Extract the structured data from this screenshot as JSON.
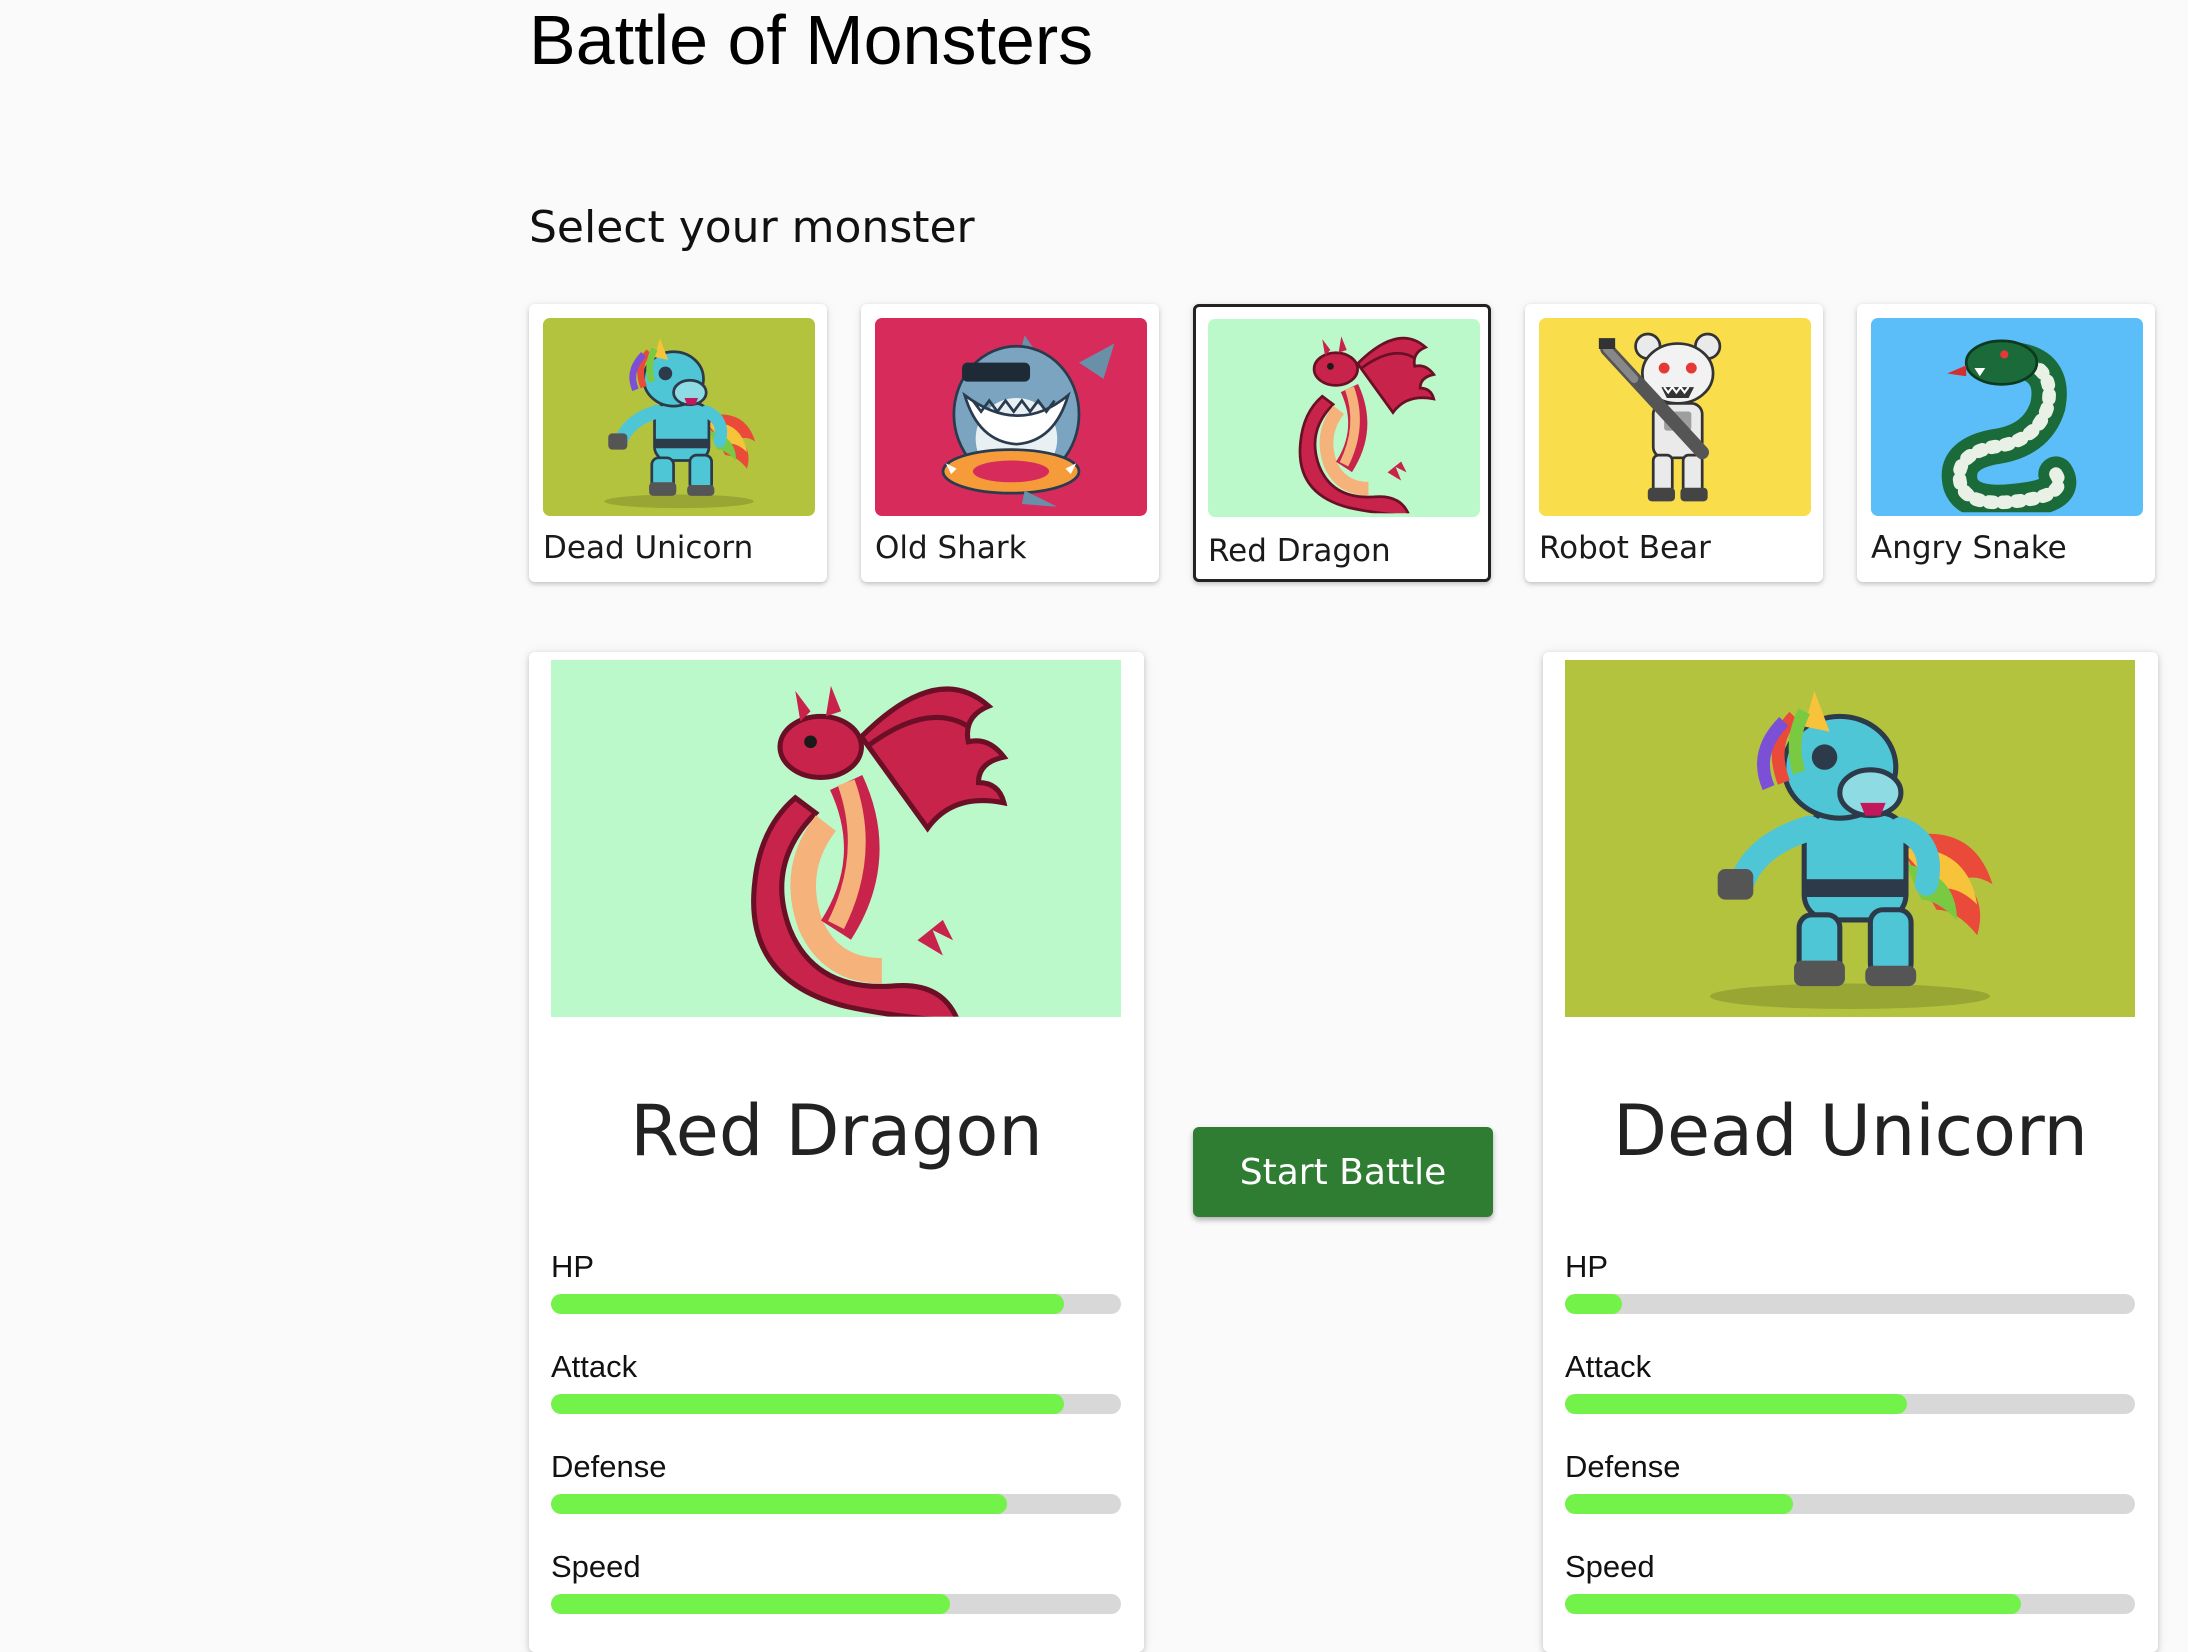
{
  "page": {
    "title": "Battle of Monsters",
    "subtitle": "Select your monster"
  },
  "monsters": [
    {
      "name": "Dead Unicorn",
      "bg": "#b3c33e",
      "icon": "unicorn-icon"
    },
    {
      "name": "Old Shark",
      "bg": "#d72b5c",
      "icon": "shark-icon"
    },
    {
      "name": "Red Dragon",
      "bg": "#bbf9cb",
      "icon": "dragon-icon",
      "selected": true
    },
    {
      "name": "Robot Bear",
      "bg": "#fadd4a",
      "icon": "bear-icon"
    },
    {
      "name": "Angry Snake",
      "bg": "#5bbef8",
      "icon": "snake-icon"
    }
  ],
  "player": {
    "name": "Red Dragon",
    "bg": "#bbf9cb",
    "stats": [
      {
        "label": "HP",
        "fill": 0.9
      },
      {
        "label": "Attack",
        "fill": 0.9
      },
      {
        "label": "Defense",
        "fill": 0.8
      },
      {
        "label": "Speed",
        "fill": 0.7
      }
    ]
  },
  "computer": {
    "name": "Dead Unicorn",
    "bg": "#b3c33e",
    "stats": [
      {
        "label": "HP",
        "fill": 0.1
      },
      {
        "label": "Attack",
        "fill": 0.6
      },
      {
        "label": "Defense",
        "fill": 0.4
      },
      {
        "label": "Speed",
        "fill": 0.8
      }
    ]
  },
  "battle_button": {
    "label": "Start Battle",
    "color": "#2e7d32"
  },
  "colors": {
    "stat_fill": "#73f24a",
    "stat_track": "#d8d8d8"
  }
}
